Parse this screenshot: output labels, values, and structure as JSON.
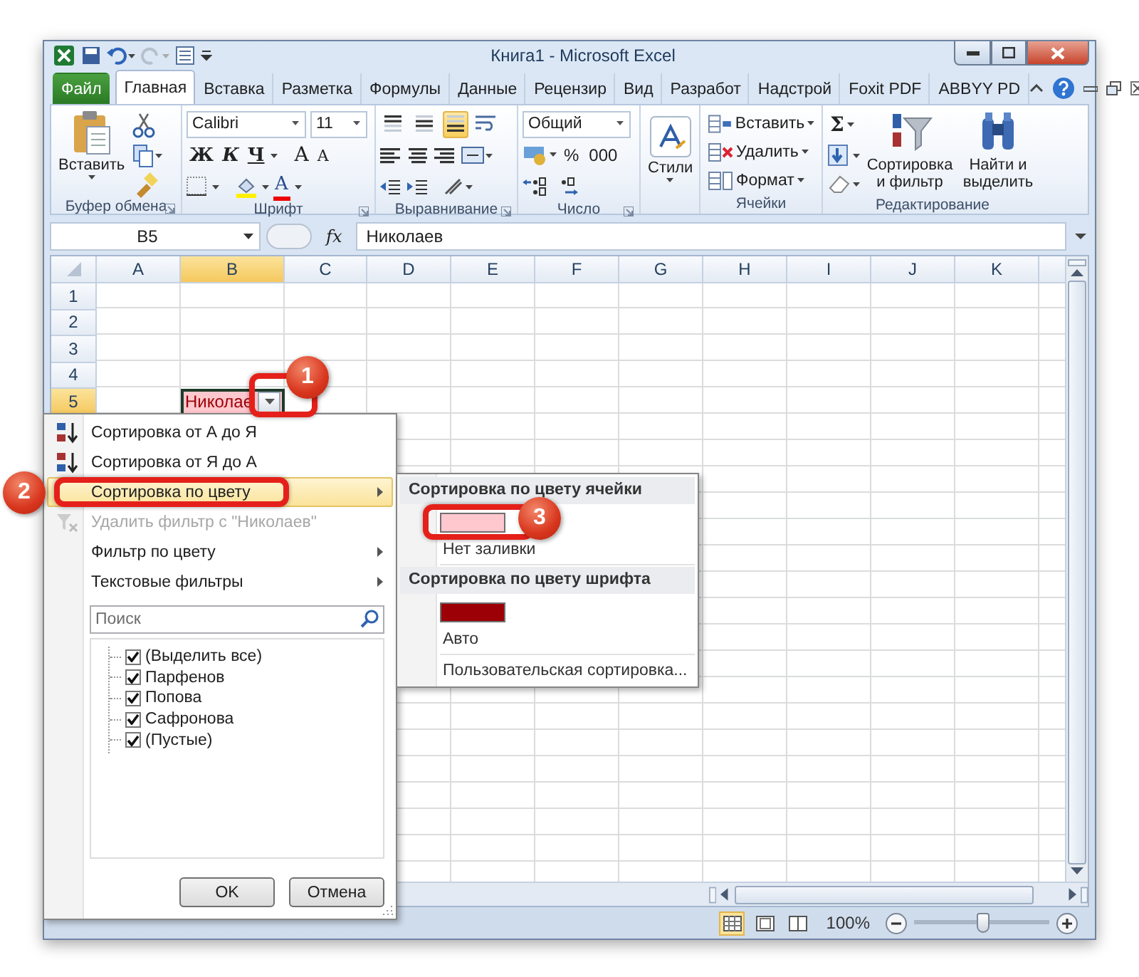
{
  "window": {
    "title": "Книга1 - Microsoft Excel"
  },
  "ribbon_tabs": [
    {
      "label": "Файл",
      "kind": "file",
      "selected": false
    },
    {
      "label": "Главная",
      "kind": "tab",
      "selected": true
    },
    {
      "label": "Вставка",
      "kind": "tab",
      "selected": false
    },
    {
      "label": "Разметка",
      "kind": "tab",
      "selected": false
    },
    {
      "label": "Формулы",
      "kind": "tab",
      "selected": false
    },
    {
      "label": "Данные",
      "kind": "tab",
      "selected": false
    },
    {
      "label": "Рецензир",
      "kind": "tab",
      "selected": false
    },
    {
      "label": "Вид",
      "kind": "tab",
      "selected": false
    },
    {
      "label": "Разработ",
      "kind": "tab",
      "selected": false
    },
    {
      "label": "Надстрой",
      "kind": "tab",
      "selected": false
    },
    {
      "label": "Foxit PDF",
      "kind": "tab",
      "selected": false
    },
    {
      "label": "ABBYY PD",
      "kind": "tab",
      "selected": false
    }
  ],
  "ribbon": {
    "clipboard": {
      "label": "Буфер обмена",
      "paste": "Вставить"
    },
    "font": {
      "label": "Шрифт",
      "name": "Calibri",
      "size": "11",
      "bold": "Ж",
      "italic": "К",
      "underline": "Ч",
      "grow": "A",
      "shrink": "A",
      "font_color": "A"
    },
    "alignment": {
      "label": "Выравнивание",
      "vertical": [
        {
          "selected": false
        },
        {
          "selected": false
        },
        {
          "selected": true
        }
      ]
    },
    "number": {
      "label": "Число",
      "format": "Общий",
      "percent": "%",
      "thousands": "000"
    },
    "styles": {
      "button": "Стили"
    },
    "cells": {
      "label": "Ячейки",
      "buttons": [
        "Вставить",
        "Удалить",
        "Формат"
      ]
    },
    "editing": {
      "label": "Редактирование",
      "sum": "Σ",
      "sort_filter": "Сортировка и фильтр",
      "find": "Найти и выделить"
    }
  },
  "formula_bar": {
    "name_box": "B5",
    "fx": "fx",
    "value": "Николаев"
  },
  "sheet": {
    "columns": [
      {
        "label": "A",
        "selected": false
      },
      {
        "label": "B",
        "selected": true
      },
      {
        "label": "C",
        "selected": false
      },
      {
        "label": "D",
        "selected": false
      },
      {
        "label": "E",
        "selected": false
      },
      {
        "label": "F",
        "selected": false
      },
      {
        "label": "G",
        "selected": false
      },
      {
        "label": "H",
        "selected": false
      },
      {
        "label": "I",
        "selected": false
      },
      {
        "label": "J",
        "selected": false
      },
      {
        "label": "K",
        "selected": false
      }
    ],
    "rows": [
      {
        "label": "1",
        "selected": false
      },
      {
        "label": "2",
        "selected": false
      },
      {
        "label": "3",
        "selected": false
      },
      {
        "label": "4",
        "selected": false
      },
      {
        "label": "5",
        "selected": true
      }
    ],
    "active_cell": "Николае"
  },
  "filter_menu": {
    "items": [
      {
        "label": "Сортировка от А до Я",
        "kind": "sort_asc",
        "selected": false,
        "disabled": false,
        "submenu": false
      },
      {
        "label": "Сортировка от Я до А",
        "kind": "sort_desc",
        "selected": false,
        "disabled": false,
        "submenu": false
      },
      {
        "label": "Сортировка по цвету",
        "kind": "plain",
        "selected": true,
        "disabled": false,
        "submenu": true
      },
      {
        "label": "Удалить фильтр с \"Николаев\"",
        "kind": "clear_filter",
        "selected": false,
        "disabled": true,
        "submenu": false
      },
      {
        "label": "Фильтр по цвету",
        "kind": "plain",
        "selected": false,
        "disabled": false,
        "submenu": true
      },
      {
        "label": "Текстовые фильтры",
        "kind": "plain",
        "selected": false,
        "disabled": false,
        "submenu": true
      }
    ],
    "search": {
      "placeholder": "Поиск"
    },
    "values": [
      {
        "label": "(Выделить все)",
        "checked": true
      },
      {
        "label": "Парфенов",
        "checked": true
      },
      {
        "label": "Попова",
        "checked": true
      },
      {
        "label": "Сафронова",
        "checked": true
      },
      {
        "label": "(Пустые)",
        "checked": true
      }
    ],
    "buttons": [
      "OK",
      "Отмена"
    ]
  },
  "color_submenu": {
    "sections": [
      {
        "title": "Сортировка по цвету ячейки",
        "color": "#ffc7ce",
        "option": "Нет заливки"
      },
      {
        "title": "Сортировка по цвету шрифта",
        "color": "#9c0006",
        "option": "Авто"
      }
    ],
    "custom": "Пользовательская сортировка..."
  },
  "status_bar": {
    "views": [
      {
        "selected": true
      },
      {
        "selected": false
      },
      {
        "selected": false
      }
    ],
    "zoom": "100%",
    "level": 0.5
  },
  "callouts": [
    "1",
    "2",
    "3"
  ]
}
